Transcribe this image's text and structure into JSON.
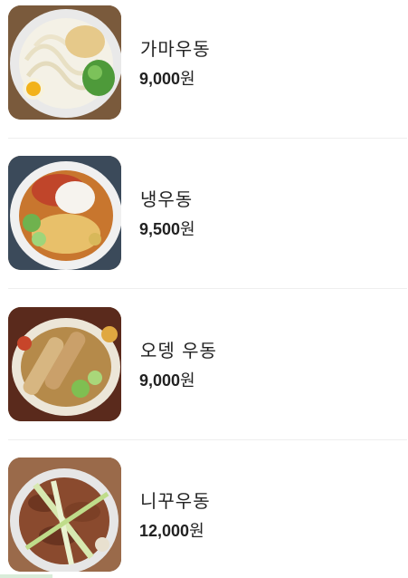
{
  "menu": {
    "items": [
      {
        "name": "가마우동",
        "price": "9,000",
        "currency": "원",
        "image_icon": "kama-udon-photo"
      },
      {
        "name": "냉우동",
        "price": "9,500",
        "currency": "원",
        "image_icon": "cold-udon-photo"
      },
      {
        "name": "오뎅 우동",
        "price": "9,000",
        "currency": "원",
        "image_icon": "oden-udon-photo"
      },
      {
        "name": "니꾸우동",
        "price": "12,000",
        "currency": "원",
        "image_icon": "niku-udon-photo"
      }
    ]
  },
  "colors": {
    "text": "#222222",
    "divider": "#eeeeee",
    "background": "#ffffff"
  }
}
